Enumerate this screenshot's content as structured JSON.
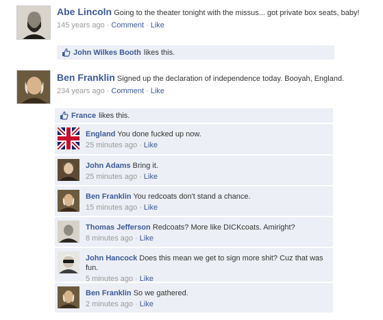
{
  "posts": [
    {
      "author": "Abe Lincoln",
      "text": "Going to the theater tonight with the missus... got private box seats, baby!",
      "time": "145 years ago",
      "comment_label": "Comment",
      "like_label": "Like",
      "liked_by": "John Wilkes Booth",
      "likes_this": "likes this."
    },
    {
      "author": "Ben Franklin",
      "text": "Signed up the declaration of independence today.  Booyah, England.",
      "time": "234 years ago",
      "comment_label": "Comment",
      "like_label": "Like",
      "liked_by": "France",
      "likes_this": "likes this.",
      "comments": [
        {
          "author": "England",
          "text": "You done fucked up now.",
          "time": "25 minutes ago",
          "like_label": "Like"
        },
        {
          "author": "John Adams",
          "text": "Bring it.",
          "time": "25 minutes ago",
          "like_label": "Like"
        },
        {
          "author": "Ben Franklin",
          "text": "You redcoats don't stand a chance.",
          "time": "15 minutes ago",
          "like_label": "Like"
        },
        {
          "author": "Thomas Jefferson",
          "text": "Redcoats?  More like DICKcoats.  Amiright?",
          "time": "8 minutes ago",
          "like_label": "Like"
        },
        {
          "author": "John Hancock",
          "text": "Does this mean we get to sign more shit?  Cuz that was fun.",
          "time": "5 minutes ago",
          "like_label": "Like"
        },
        {
          "author": "Ben Franklin",
          "text": "So we gathered.",
          "time": "2 minutes ago",
          "like_label": "Like"
        }
      ]
    }
  ],
  "colors": {
    "link": "#3b5998",
    "comment_bg": "#eceff5",
    "meta": "#999999"
  }
}
